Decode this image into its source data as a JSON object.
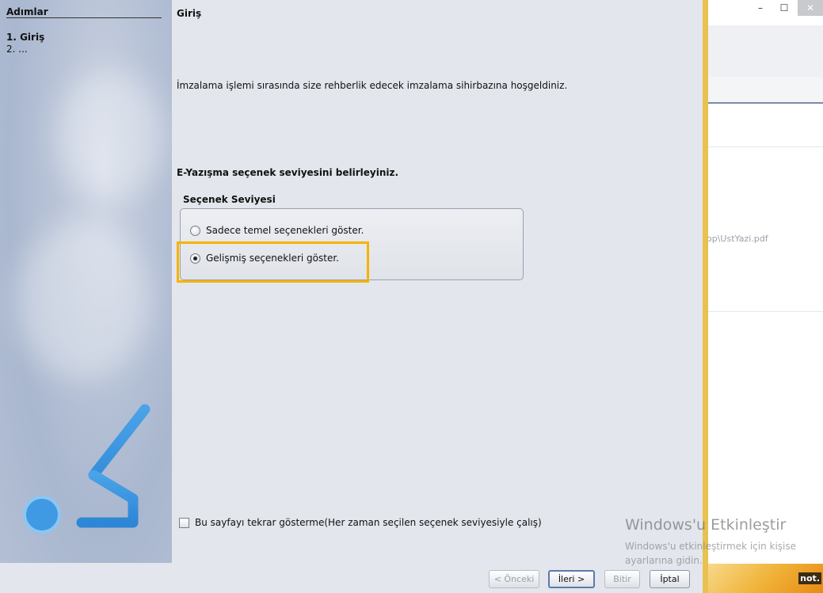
{
  "wizard": {
    "steps_header": "Adımlar",
    "steps": [
      "1. Giriş",
      "2. ..."
    ],
    "content_title": "Giriş",
    "intro_text": "İmzalama işlemi sırasında size rehberlik edecek imzalama sihirbazına hoşgeldiniz.",
    "question": "E-Yazışma seçenek seviyesini  belirleyiniz.",
    "option_group": {
      "title": "Seçenek Seviyesi",
      "options": [
        {
          "label": "Sadece temel seçenekleri göster.",
          "selected": false
        },
        {
          "label": "Gelişmiş seçenekleri göster.",
          "selected": true
        }
      ]
    },
    "dont_show_checkbox": {
      "label": "Bu sayfayı tekrar gösterme(Her zaman seçilen seçenek seviyesiyle çalış)",
      "checked": false
    },
    "buttons": {
      "prev": "< Önceki",
      "next": "İleri >",
      "finish": "Bitir",
      "cancel": "İptal"
    },
    "highlight_color": "#f5b400"
  },
  "background_window": {
    "window_controls": {
      "minimize": "–",
      "maximize": "☐",
      "close": "✕"
    },
    "path_fragment": "op\\UstYazi.pdf",
    "bottom_label": "not."
  },
  "watermark": {
    "title": "Windows'u Etkinleştir",
    "line1": "Windows'u etkinleştirmek için kişise",
    "line2": "ayarlarına gidin."
  }
}
